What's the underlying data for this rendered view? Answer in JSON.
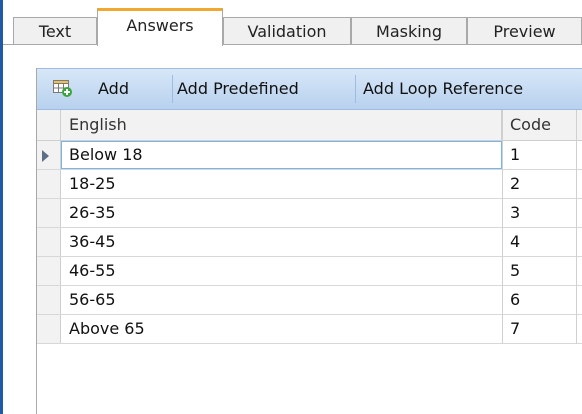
{
  "tabs": [
    {
      "label": "Text"
    },
    {
      "label": "Answers"
    },
    {
      "label": "Validation"
    },
    {
      "label": "Masking"
    },
    {
      "label": "Preview"
    }
  ],
  "active_tab": "Answers",
  "toolbar": {
    "add_label": "Add",
    "add_predefined_label": "Add Predefined",
    "add_loop_reference_label": "Add Loop Reference"
  },
  "grid": {
    "columns": [
      "English",
      "Code"
    ],
    "rows": [
      {
        "english": "Below 18",
        "code": "1"
      },
      {
        "english": "18-25",
        "code": "2"
      },
      {
        "english": "26-35",
        "code": "3"
      },
      {
        "english": "36-45",
        "code": "4"
      },
      {
        "english": "46-55",
        "code": "5"
      },
      {
        "english": "56-65",
        "code": "6"
      },
      {
        "english": "Above 65",
        "code": "7"
      }
    ]
  },
  "icons": {
    "add": "add-grid-icon",
    "row_indicator": "current-row-arrow-icon"
  },
  "colors": {
    "tab_accent": "#f0a830",
    "toolbar_top": "#d7e7f8",
    "toolbar_bottom": "#b8d1ee",
    "window_border": "#1e5aa8",
    "cell_focus": "#7ab5e6"
  }
}
